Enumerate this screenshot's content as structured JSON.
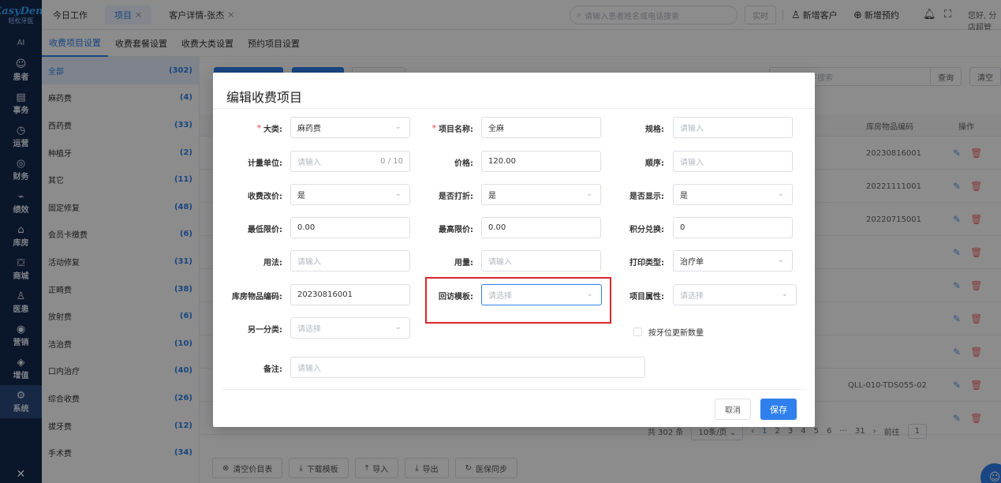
{
  "brand": {
    "name": "EasyDent",
    "sub": "轻松牙医"
  },
  "nav": {
    "ai": "AI",
    "items": [
      {
        "icon": "☺",
        "label": "患者",
        "icon_name": "patient-icon"
      },
      {
        "icon": "▤",
        "label": "事务",
        "icon_name": "task-icon"
      },
      {
        "icon": "◷",
        "label": "运营",
        "icon_name": "operation-icon"
      },
      {
        "icon": "◎",
        "label": "财务",
        "icon_name": "finance-icon"
      },
      {
        "icon": "⌁",
        "label": "绩效",
        "icon_name": "performance-icon"
      },
      {
        "icon": "⌂",
        "label": "库房",
        "icon_name": "warehouse-icon"
      },
      {
        "icon": "⛋",
        "label": "商城",
        "icon_name": "mall-icon"
      },
      {
        "icon": "♙",
        "label": "医患",
        "icon_name": "doctor-patient-icon"
      },
      {
        "icon": "◉",
        "label": "营销",
        "icon_name": "marketing-icon"
      },
      {
        "icon": "◈",
        "label": "增值",
        "icon_name": "value-added-icon"
      },
      {
        "icon": "⚙",
        "label": "系统",
        "icon_name": "system-icon"
      }
    ],
    "bottom": "✕"
  },
  "topbar": {
    "tabs": [
      {
        "label": "今日工作",
        "closable": false
      },
      {
        "label": "项目",
        "closable": true,
        "active": true
      },
      {
        "label": "客户详情-张杰",
        "closable": true
      }
    ],
    "close": "×",
    "search_placeholder": "请输入患者姓名或电话搜索",
    "realtime": "实时",
    "new_customer": "新增客户",
    "new_booking": "新增预约",
    "greeting": "您好, 分店超管"
  },
  "subtabs": [
    "收费项目设置",
    "收费套餐设置",
    "收费大类设置",
    "预约项目设置"
  ],
  "categories": [
    {
      "name": "全部",
      "count": "(302)"
    },
    {
      "name": "麻药费",
      "count": "(4)"
    },
    {
      "name": "西药费",
      "count": "(33)"
    },
    {
      "name": "种植牙",
      "count": "(2)"
    },
    {
      "name": "其它",
      "count": "(11)"
    },
    {
      "name": "固定修复",
      "count": "(48)"
    },
    {
      "name": "会员卡缴费",
      "count": "(6)"
    },
    {
      "name": "活动修复",
      "count": "(31)"
    },
    {
      "name": "正畸费",
      "count": "(38)"
    },
    {
      "name": "放射费",
      "count": "(6)"
    },
    {
      "name": "洁治费",
      "count": "(10)"
    },
    {
      "name": "口内治疗",
      "count": "(40)"
    },
    {
      "name": "综合收费",
      "count": "(26)"
    },
    {
      "name": "拔牙费",
      "count": "(12)"
    },
    {
      "name": "手术费",
      "count": "(34)"
    }
  ],
  "background": {
    "search_placeholder": "字搜索",
    "query_btn": "查询",
    "reset_btn": "清空",
    "col_code": "库房物品编码",
    "col_ops": "操作",
    "rows": [
      "20230816001",
      "20221111001",
      "20220715001",
      "",
      "",
      "",
      "",
      "QLL-010-TDS055-02",
      ""
    ],
    "pager": {
      "total": "共 302 条",
      "size": "10条/页",
      "pages": [
        "1",
        "2",
        "3",
        "4",
        "5",
        "6",
        "···",
        "31"
      ],
      "goto": "前往",
      "goto_val": "1"
    },
    "bottom_buttons": [
      {
        "icon": "⊗",
        "label": "清空价目表"
      },
      {
        "icon": "⤓",
        "label": "下载模板"
      },
      {
        "icon": "⤒",
        "label": "导入"
      },
      {
        "icon": "⤓",
        "label": "导出"
      },
      {
        "icon": "↻",
        "label": "医保同步"
      }
    ]
  },
  "modal": {
    "title": "编辑收费项目",
    "fields": {
      "category": {
        "label": "大类:",
        "value": "麻药费",
        "required": true
      },
      "name": {
        "label": "项目名称:",
        "value": "全麻",
        "required": true
      },
      "spec": {
        "label": "规格:",
        "placeholder": "请输入"
      },
      "unit": {
        "label": "计量单位:",
        "placeholder": "请输入",
        "counter": "0 / 10"
      },
      "price": {
        "label": "价格:",
        "value": "120.00"
      },
      "order": {
        "label": "顺序:",
        "placeholder": "请输入"
      },
      "price_edit": {
        "label": "收费改价:",
        "value": "是"
      },
      "discount": {
        "label": "是否打折:",
        "value": "是"
      },
      "display": {
        "label": "是否显示:",
        "value": "是"
      },
      "min_price": {
        "label": "最低限价:",
        "value": "0.00"
      },
      "max_price": {
        "label": "最高限价:",
        "value": "0.00"
      },
      "points": {
        "label": "积分兑换:",
        "value": "0"
      },
      "usage": {
        "label": "用法:",
        "placeholder": "请输入"
      },
      "dosage": {
        "label": "用量:",
        "placeholder": "请输入"
      },
      "print_type": {
        "label": "打印类型:",
        "value": "治疗单"
      },
      "stock_code": {
        "label": "库房物品编码:",
        "value": "20230816001"
      },
      "followup": {
        "label": "回访模板:",
        "placeholder": "请选择"
      },
      "attribute": {
        "label": "项目属性:",
        "placeholder": "请选择"
      },
      "other_class": {
        "label": "另一分类:",
        "placeholder": "请选择"
      },
      "by_tooth": {
        "label": "按牙位更新数量"
      },
      "remark": {
        "label": "备注:",
        "placeholder": "请输入"
      }
    },
    "cancel": "取消",
    "save": "保存"
  }
}
